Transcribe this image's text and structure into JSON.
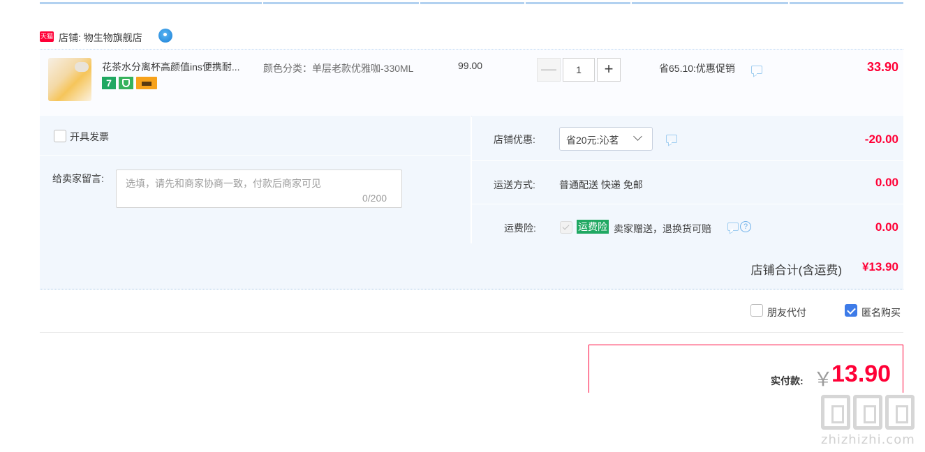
{
  "shop": {
    "icon_text": "天猫",
    "label": "店铺: 物生物旗舰店"
  },
  "item": {
    "title": "花茶水分离杯高颜值ins便携耐...",
    "badge_seven": "7",
    "sku": "颜色分类：单层老款优雅咖-330ML",
    "price": "99.00",
    "quantity": "1",
    "minus": "—",
    "plus": "+",
    "promo": "省65.10:优惠促销",
    "subtotal": "33.90"
  },
  "invoice": {
    "label": "开具发票",
    "checked": false
  },
  "message": {
    "label": "给卖家留言:",
    "placeholder": "选填，请先和商家协商一致，付款后商家可见",
    "count": "0/200"
  },
  "shop_discount": {
    "label": "店铺优惠:",
    "selected": "省20元:沁茗",
    "amount": "-20.00"
  },
  "shipping": {
    "label": "运送方式:",
    "value": "普通配送 快递 免邮",
    "amount": "0.00"
  },
  "insurance": {
    "label": "运费险:",
    "tag": "运费险",
    "desc": "卖家赠送，退换货可赔",
    "help": "?",
    "amount": "0.00"
  },
  "shop_total": {
    "label": "店铺合计(含运费)",
    "value": "¥13.90"
  },
  "options": {
    "friend_pay": "朋友代付",
    "friend_pay_checked": false,
    "anonymous": "匿名购买",
    "anonymous_checked": true
  },
  "payment": {
    "label": "实付款:",
    "currency": "￥",
    "value": "13.90"
  },
  "watermark": {
    "site": "zhizhizhi.com"
  },
  "colors": {
    "accent_red": "#ff0036",
    "panel_bg": "#f2f7fd",
    "checkbox_blue": "#3d7be8",
    "tag_green": "#20a862"
  },
  "icons": [
    "tmall-shop-icon",
    "wangwang-chat-icon",
    "message-icon",
    "help-icon",
    "chevron-down-icon"
  ]
}
